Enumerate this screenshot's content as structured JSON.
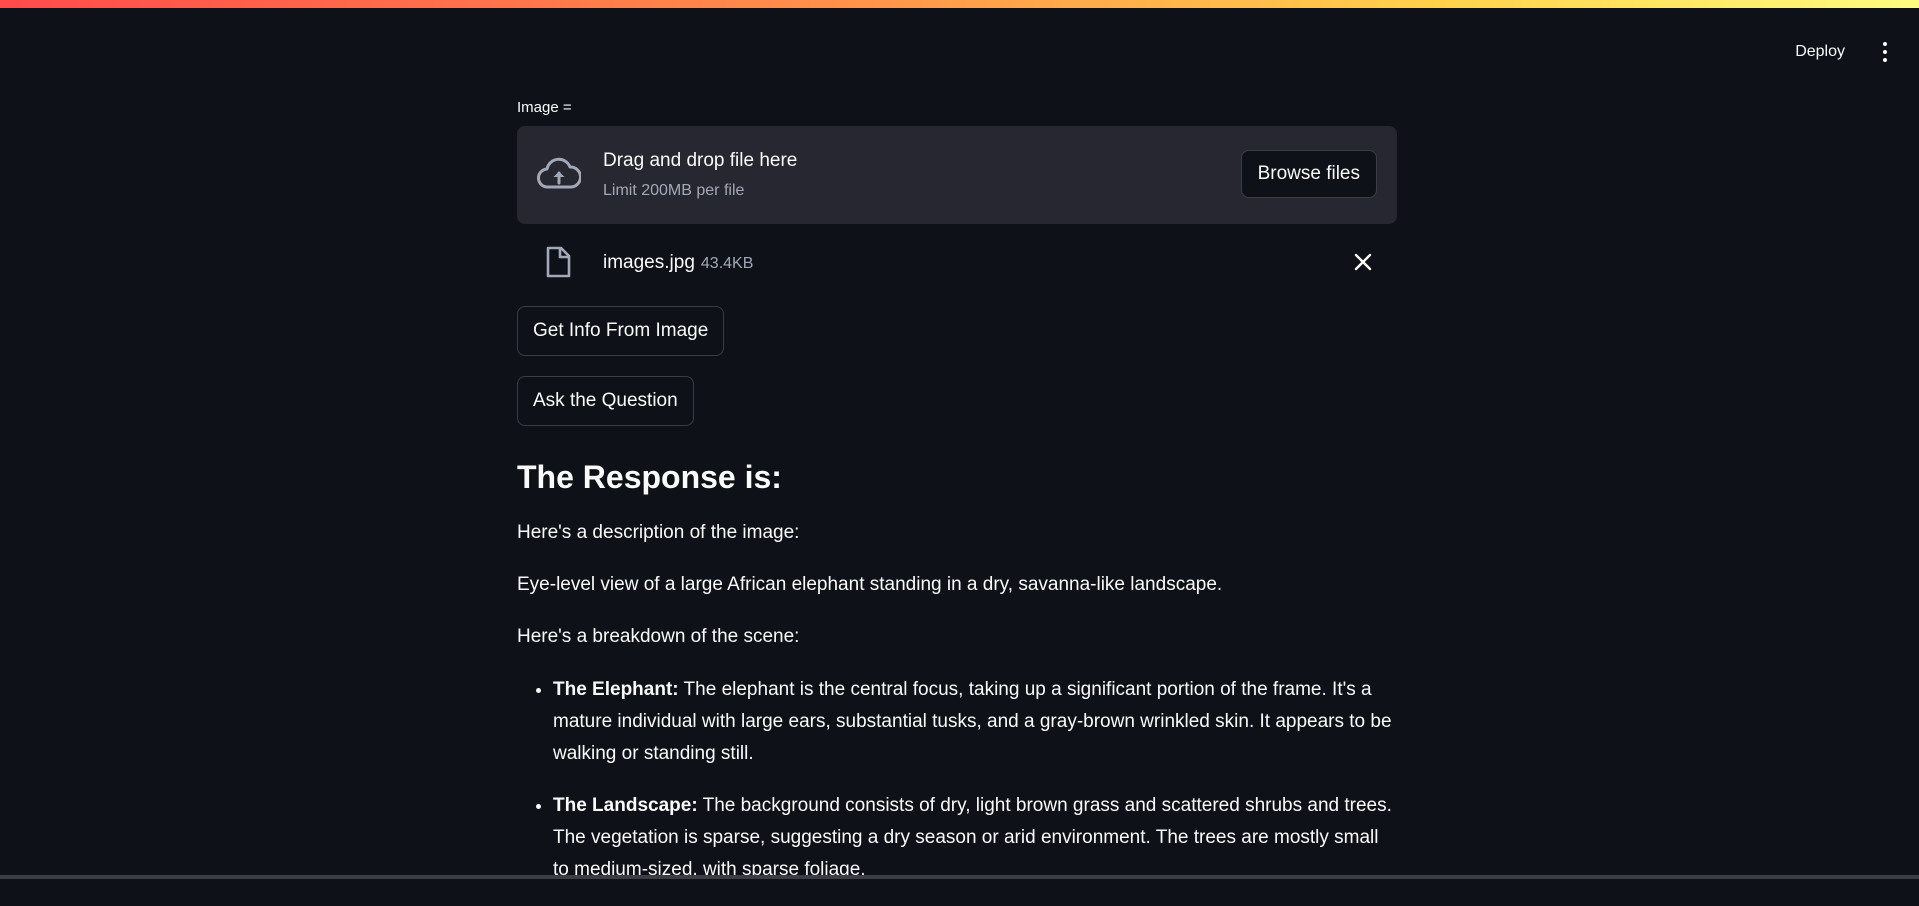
{
  "header": {
    "deploy_label": "Deploy",
    "menu_icon": "more-vertical-icon"
  },
  "uploader": {
    "label": "Image =",
    "drop_title": "Drag and drop file here",
    "drop_limit": "Limit 200MB per file",
    "browse_label": "Browse files",
    "upload_icon": "cloud-upload-icon"
  },
  "file": {
    "name": "images.jpg",
    "size": "43.4KB",
    "icon": "file-icon",
    "remove_icon": "close-icon"
  },
  "buttons": {
    "get_info": "Get Info From Image",
    "ask_question": "Ask the Question"
  },
  "response": {
    "heading": "The Response is:",
    "intro": "Here's a description of the image:",
    "summary": "Eye-level view of a large African elephant standing in a dry, savanna-like landscape.",
    "breakdown_intro": "Here's a breakdown of the scene:",
    "items": [
      {
        "title": "The Elephant:",
        "text": " The elephant is the central focus, taking up a significant portion of the frame. It's a mature individual with large ears, substantial tusks, and a gray-brown wrinkled skin. It appears to be walking or standing still."
      },
      {
        "title": "The Landscape:",
        "text": " The background consists of dry, light brown grass and scattered shrubs and trees. The vegetation is sparse, suggesting a dry season or arid environment. The trees are mostly small to medium-sized, with sparse foliage."
      }
    ]
  },
  "colors": {
    "background": "#0e1117",
    "panel": "#262730",
    "text": "#fafafa",
    "muted": "#a3a8b8"
  }
}
